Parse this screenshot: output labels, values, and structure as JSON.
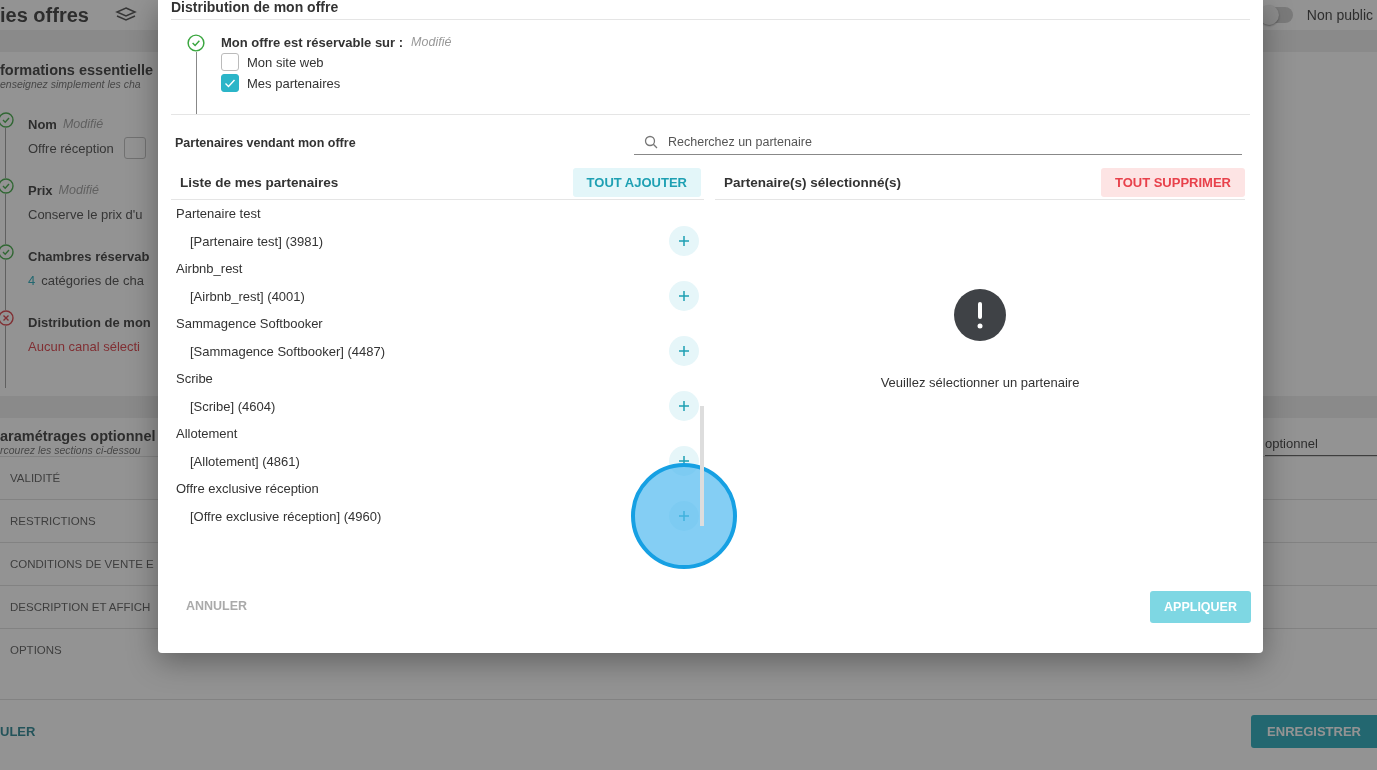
{
  "page": {
    "title": "ies offres",
    "toggle": {
      "label": "Non public",
      "on": false
    },
    "essentials": {
      "title": "formations essentielle",
      "subtitle": "enseignez simplement les cha",
      "steps": [
        {
          "label": "Nom",
          "done": true,
          "note": "Modifié",
          "value": "Offre réception",
          "editable": true
        },
        {
          "label": "Prix",
          "done": true,
          "note": "Modifié",
          "value": "Conserve le prix d'u",
          "editable": false
        },
        {
          "label": "Chambres réservab",
          "done": true,
          "count": "4",
          "value": "catégories de cha",
          "editable": false
        },
        {
          "label": "Distribution de mon",
          "done": false,
          "value": "Aucun canal sélecti",
          "editable": false
        }
      ]
    },
    "optional": {
      "title": "aramétrages optionnel",
      "subtitle": "rcourez les sections ci-dessou",
      "field_value": "optionnel",
      "sections": [
        "VALIDITÉ",
        "RESTRICTIONS",
        "CONDITIONS DE VENTE E",
        "DESCRIPTION ET AFFICH",
        "OPTIONS"
      ]
    },
    "cancel": "ULER",
    "save": "ENREGISTRER"
  },
  "dialog": {
    "title": "Distribution de mon offre",
    "availability": {
      "done": true,
      "label": "Mon offre est réservable sur :",
      "note": "Modifié",
      "options": [
        {
          "label": "Mon site web",
          "checked": false
        },
        {
          "label": "Mes partenaires",
          "checked": true
        }
      ]
    },
    "partners_title": "Partenaires vendant mon offre",
    "search": {
      "placeholder": "Recherchez un partenaire"
    },
    "list_title": "Liste de mes partenaires",
    "add_all": "TOUT AJOUTER",
    "selected_title": "Partenaire(s) sélectionné(s)",
    "remove_all": "TOUT SUPPRIMER",
    "groups": [
      {
        "name": "Partenaire test",
        "items": [
          {
            "label": "[Partenaire test] (3981)",
            "pressed": false
          }
        ]
      },
      {
        "name": "Airbnb_rest",
        "items": [
          {
            "label": "[Airbnb_rest] (4001)",
            "pressed": false
          }
        ]
      },
      {
        "name": "Sammagence Softbooker",
        "items": [
          {
            "label": "[Sammagence Softbooker] (4487)",
            "pressed": false
          }
        ]
      },
      {
        "name": "Scribe",
        "items": [
          {
            "label": "[Scribe] (4604)",
            "pressed": false
          }
        ]
      },
      {
        "name": "Allotement",
        "items": [
          {
            "label": "[Allotement] (4861)",
            "pressed": false
          }
        ]
      },
      {
        "name": "Offre exclusive réception",
        "items": [
          {
            "label": "[Offre exclusive réception] (4960)",
            "pressed": true
          }
        ]
      }
    ],
    "empty_message": "Veuillez sélectionner un partenaire",
    "cancel": "ANNULER",
    "apply": "APPLIQUER"
  }
}
